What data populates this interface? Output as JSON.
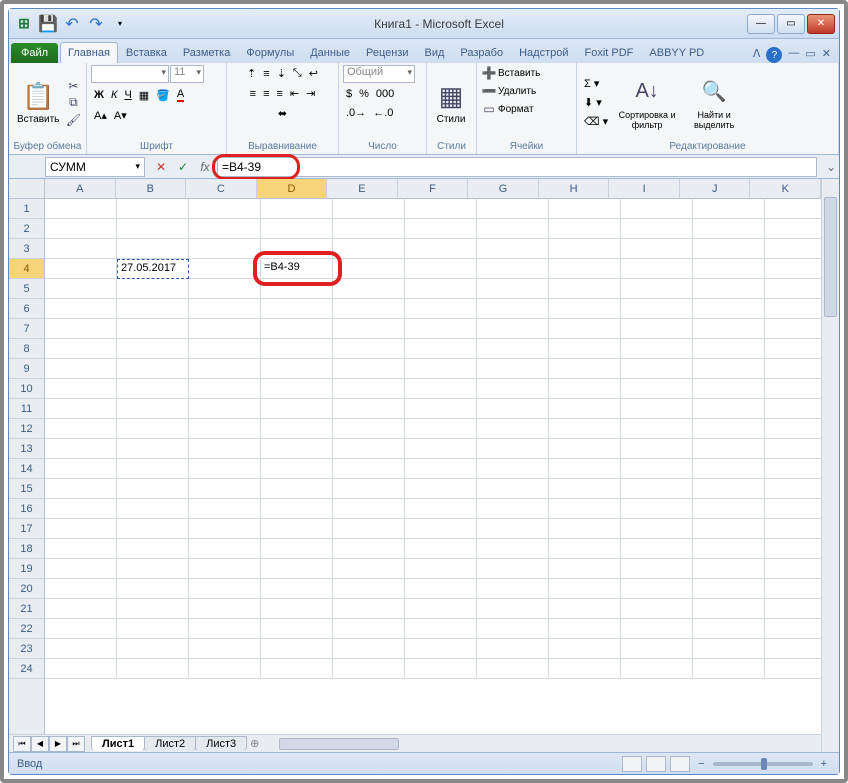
{
  "window": {
    "title": "Книга1 - Microsoft Excel"
  },
  "qat": {
    "excel_icon": "excel-icon",
    "save": "save-icon",
    "undo": "undo-icon",
    "redo": "redo-icon"
  },
  "tabs": {
    "file": "Файл",
    "items": [
      "Главная",
      "Вставка",
      "Разметка",
      "Формулы",
      "Данные",
      "Рецензи",
      "Вид",
      "Разрабо",
      "Надстрой",
      "Foxit PDF",
      "ABBYY PD"
    ],
    "active_index": 0
  },
  "ribbon": {
    "clipboard": {
      "label": "Буфер обмена",
      "paste": "Вставить"
    },
    "font": {
      "label": "Шрифт",
      "font_name": "",
      "font_size": "11"
    },
    "alignment": {
      "label": "Выравнивание"
    },
    "number": {
      "label": "Число",
      "format": "Общий"
    },
    "styles": {
      "label": "Стили",
      "styles_btn": "Стили"
    },
    "cells": {
      "label": "Ячейки",
      "insert": "Вставить",
      "delete": "Удалить",
      "format": "Формат"
    },
    "editing": {
      "label": "Редактирование",
      "sort": "Сортировка и фильтр",
      "find": "Найти и выделить"
    }
  },
  "formula_bar": {
    "name_box": "СУММ",
    "formula": "=B4-39"
  },
  "grid": {
    "columns": [
      "A",
      "B",
      "C",
      "D",
      "E",
      "F",
      "G",
      "H",
      "I",
      "J",
      "K"
    ],
    "rows": 24,
    "active_col": "D",
    "active_row": 4,
    "cells": {
      "B4": "27.05.2017",
      "D4": "=B4-39"
    }
  },
  "sheets": {
    "tabs": [
      "Лист1",
      "Лист2",
      "Лист3"
    ],
    "active_index": 0
  },
  "statusbar": {
    "mode": "Ввод",
    "zoom_minus": "−",
    "zoom_plus": "+"
  }
}
